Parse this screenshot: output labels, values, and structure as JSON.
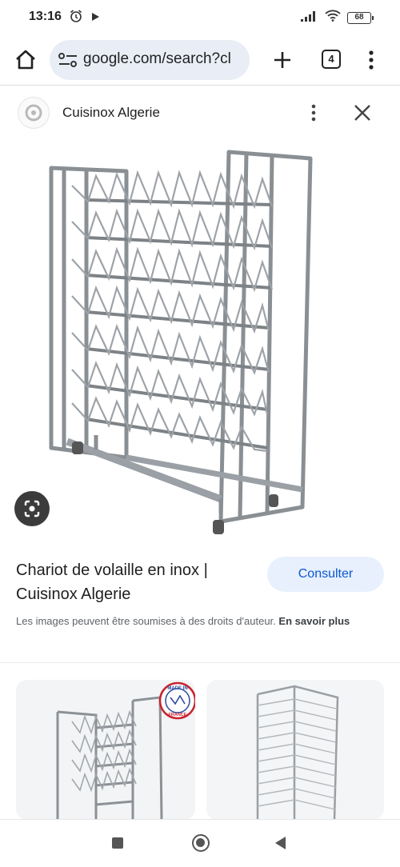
{
  "status": {
    "time": "13:16",
    "battery": "68"
  },
  "browser": {
    "url": "google.com/search?cl",
    "tab_count": "4"
  },
  "viewer": {
    "source_name": "Cuisinox Algerie",
    "title": "Chariot de volaille en inox | Cuisinox Algerie",
    "visit_button": "Consulter",
    "copyright_text": "Les images peuvent être soumises à des droits d'auteur.",
    "learn_more": "En savoir plus"
  },
  "related": {
    "badge_text_top": "MADE IN",
    "badge_text_bottom": "FRANCE"
  },
  "colors": {
    "accent": "#0b57d0",
    "button_bg": "#e8f0fe",
    "omnibox_bg": "#e9eef6"
  },
  "icons": [
    "alarm-icon",
    "play-icon",
    "signal-icon",
    "wifi-icon",
    "battery-icon",
    "home-icon",
    "tune-icon",
    "plus-icon",
    "tabs-icon",
    "more-vert-icon",
    "close-icon",
    "lens-icon",
    "nav-recents-icon",
    "nav-home-icon",
    "nav-back-icon"
  ]
}
